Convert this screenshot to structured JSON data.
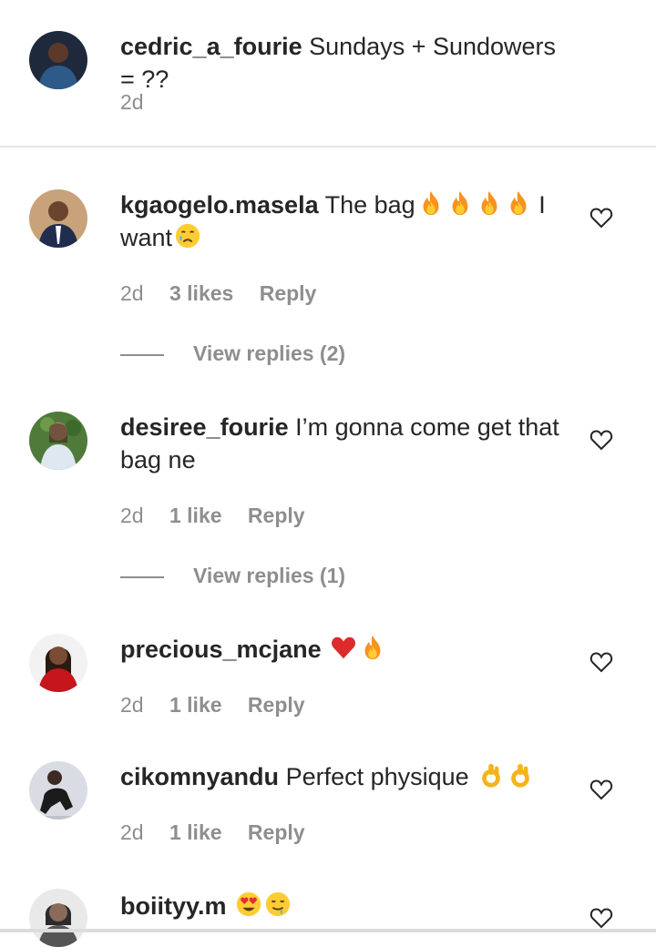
{
  "caption": {
    "username": "cedric_a_fourie",
    "text": "Sundays + Sundowers = ??",
    "time": "2d",
    "avatar_colors": {
      "bg": "#1e2a3c",
      "skin": "#5b3a2b",
      "cloth": "#2d5a88"
    }
  },
  "comments": [
    {
      "username": "kgaogelo.masela",
      "text_before": "The bag",
      "emojis_mid": [
        "fire",
        "fire",
        "fire",
        "fire"
      ],
      "text_after": "I want",
      "emojis_end": [
        "crying-face"
      ],
      "time": "2d",
      "likes": "3 likes",
      "reply": "Reply",
      "view_replies": "View replies (2)",
      "avatar_colors": {
        "bg": "#c8a27a",
        "skin": "#6b4430",
        "cloth": "#1f2d4e"
      }
    },
    {
      "username": "desiree_fourie",
      "text": "I’m gonna come get that bag ne",
      "time": "2d",
      "likes": "1 like",
      "reply": "Reply",
      "view_replies": "View replies (1)",
      "avatar_colors": {
        "bg": "#4f7a3a",
        "skin": "#c99a7a",
        "cloth": "#dfe8f0"
      }
    },
    {
      "username": "precious_mcjane",
      "emojis": [
        "red-heart",
        "fire"
      ],
      "time": "2d",
      "likes": "1 like",
      "reply": "Reply",
      "avatar_colors": {
        "bg": "#f2f2f2",
        "skin": "#7a4b35",
        "cloth": "#c4161c"
      }
    },
    {
      "username": "cikomnyandu",
      "text": "Perfect physique",
      "emojis": [
        "ok-hand",
        "ok-hand"
      ],
      "time": "2d",
      "likes": "1 like",
      "reply": "Reply",
      "avatar_colors": {
        "bg": "#d9dde3",
        "skin": "#3d2a22",
        "cloth": "#1b1b1b"
      }
    },
    {
      "username": "boiityy.m",
      "emojis": [
        "heart-eyes",
        "drooling-face"
      ],
      "avatar_colors": {
        "bg": "#e9e9e9",
        "skin": "#8a6a5a",
        "cloth": "#555555"
      }
    }
  ],
  "colors": {
    "text": "#262626",
    "secondary": "#8e8e8e",
    "divider": "#e6e6e6"
  }
}
